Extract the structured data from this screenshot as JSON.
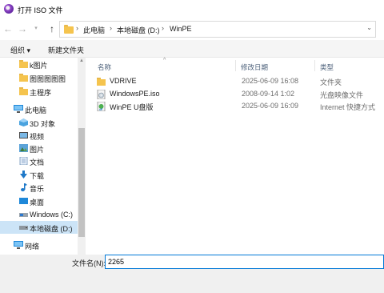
{
  "window": {
    "title": "打开 ISO 文件"
  },
  "nav": {
    "back_icon": "arrow-left-icon",
    "forward_icon": "arrow-right-icon",
    "recent_icon": "chevron-down-icon",
    "up_icon": "arrow-up-icon"
  },
  "address": {
    "crumbs": [
      "此电脑",
      "本地磁盘 (D:)",
      "WinPE"
    ],
    "separator": "›"
  },
  "toolbar": {
    "organize": "组织 ▾",
    "new_folder": "新建文件夹"
  },
  "sidebar": {
    "items": [
      {
        "label": "k图片",
        "icon": "folder-icon"
      },
      {
        "label": "图图图图图",
        "icon": "folder-icon"
      },
      {
        "label": "主程序",
        "icon": "folder-icon"
      },
      {
        "label": "此电脑",
        "icon": "computer-icon"
      },
      {
        "label": "3D 对象",
        "icon": "3d-objects-icon"
      },
      {
        "label": "视频",
        "icon": "video-icon"
      },
      {
        "label": "图片",
        "icon": "pictures-icon"
      },
      {
        "label": "文档",
        "icon": "documents-icon"
      },
      {
        "label": "下载",
        "icon": "download-icon"
      },
      {
        "label": "音乐",
        "icon": "music-icon"
      },
      {
        "label": "桌面",
        "icon": "desktop-icon"
      },
      {
        "label": "Windows (C:)",
        "icon": "drive-icon"
      },
      {
        "label": "本地磁盘 (D:)",
        "icon": "drive-icon",
        "selected": true
      },
      {
        "label": "网络",
        "icon": "network-icon"
      }
    ]
  },
  "columns": {
    "name": "名称",
    "date": "修改日期",
    "type": "类型"
  },
  "files": [
    {
      "name": "VDRIVE",
      "date": "2025-06-09 16:08",
      "type": "文件夹",
      "icon": "folder-icon"
    },
    {
      "name": "WindowsPE.iso",
      "date": "2008-09-14 1:02",
      "type": "光盘映像文件",
      "icon": "iso-file-icon"
    },
    {
      "name": "WinPE U盘版",
      "date": "2025-06-09 16:09",
      "type": "Internet 快捷方式",
      "icon": "shortcut-icon"
    }
  ],
  "filename": {
    "label": "文件名(N):",
    "value": "2265"
  }
}
